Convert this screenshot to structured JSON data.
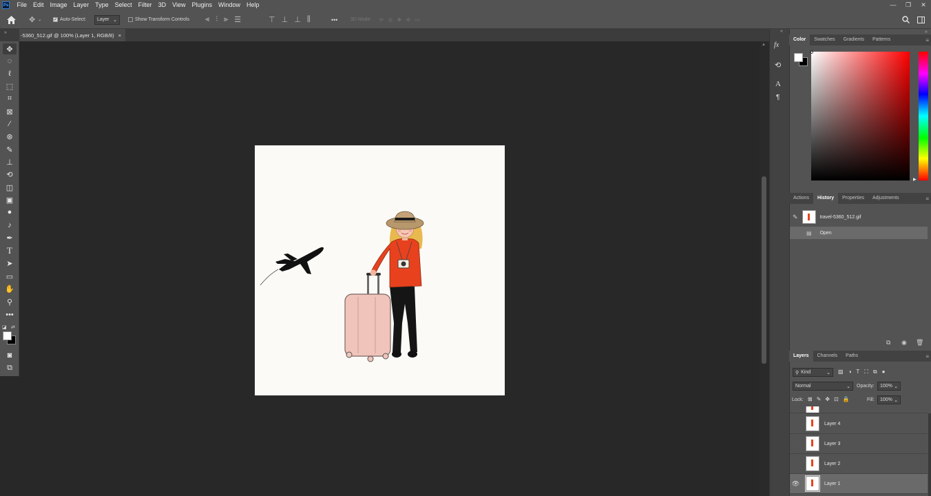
{
  "app": {
    "logo": "Ps"
  },
  "menu": [
    "File",
    "Edit",
    "Image",
    "Layer",
    "Type",
    "Select",
    "Filter",
    "3D",
    "View",
    "Plugins",
    "Window",
    "Help"
  ],
  "window_controls": {
    "minimize": "—",
    "restore": "❐",
    "close": "✕"
  },
  "options": {
    "auto_select_label": "Auto-Select:",
    "auto_select_target": "Layer",
    "show_transform_label": "Show Transform Controls",
    "more": "•••",
    "mode_3d_label": "3D Mode:"
  },
  "document_tab": {
    "title": "-5360_512.gif @ 100% (Layer 1, RGB/8)",
    "close": "×"
  },
  "color_panel": {
    "tabs": [
      "Color",
      "Swatches",
      "Gradients",
      "Patterns"
    ],
    "active": "Color",
    "fg": "#ffffff",
    "bg": "#000000"
  },
  "history_panel": {
    "tabs": [
      "Actions",
      "History",
      "Properties",
      "Adjustments"
    ],
    "active": "History",
    "snapshot": "travel-5360_512.gif",
    "states": [
      "Open"
    ]
  },
  "layers_panel": {
    "tabs": [
      "Layers",
      "Channels",
      "Paths"
    ],
    "active": "Layers",
    "filter_kind": "Kind",
    "blend_mode": "Normal",
    "opacity_label": "Opacity:",
    "opacity_value": "100%",
    "lock_label": "Lock:",
    "fill_label": "Fill:",
    "fill_value": "100%",
    "layers": [
      {
        "name": "Layer 4",
        "visible": false
      },
      {
        "name": "Layer 3",
        "visible": false
      },
      {
        "name": "Layer 2",
        "visible": false
      },
      {
        "name": "Layer 1",
        "visible": true,
        "selected": true
      }
    ]
  },
  "colors": {
    "ui_bg": "#535353",
    "workspace": "#282828",
    "canvas": "#fbfaf7",
    "sweater": "#e8411e",
    "suitcase": "#f0c4bb"
  }
}
